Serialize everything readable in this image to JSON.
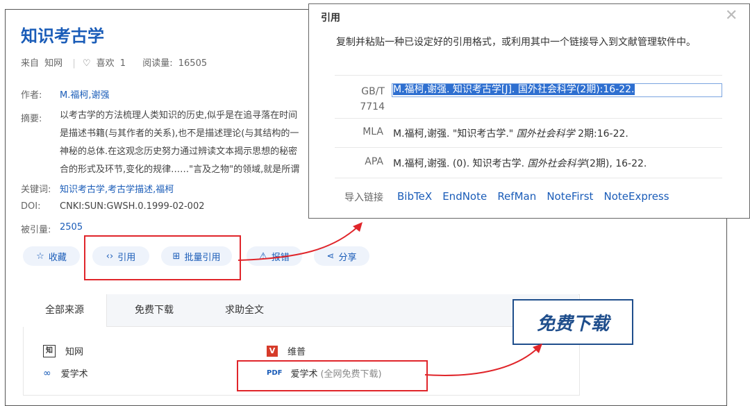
{
  "article": {
    "title": "知识考古学",
    "source_label": "来自",
    "source": "知网",
    "like_icon": "heart-icon",
    "like_label": "喜欢",
    "like_count": "1",
    "reads_label": "阅读量:",
    "reads": "16505",
    "author_label": "作者:",
    "authors": "M.福柯,谢强",
    "abstract_label": "摘要:",
    "abstract_lines": [
      "以考古学的方法梳理人类知识的历史,似乎是在追寻落在时间",
      "是描述书籍(与其作者的关系),也不是描述理论(与其结构的一",
      "神秘的总体.在这观念历史努力通过辨读文本揭示思想的秘密",
      "合的形式及环节,变化的规律……\"言及之物\"的领域,就是所谓"
    ],
    "keywords_label": "关键词:",
    "keywords": "知识考古学,考古学描述,福柯",
    "doi_label": "DOI:",
    "doi": "CNKI:SUN:GWSH.0.1999-02-002",
    "cited_label": "被引量:",
    "cited": "2505"
  },
  "actions": [
    {
      "label": "收藏",
      "icon": "star-icon"
    },
    {
      "label": "引用",
      "icon": "code-icon"
    },
    {
      "label": "批量引用",
      "icon": "folder-plus-icon"
    },
    {
      "label": "报错",
      "icon": "warning-icon"
    },
    {
      "label": "分享",
      "icon": "share-icon"
    }
  ],
  "tabs": [
    "全部来源",
    "免费下载",
    "求助全文"
  ],
  "sources": [
    {
      "name": "知网",
      "icon": "cnki-icon"
    },
    {
      "name": "维普",
      "icon": "vip-icon"
    },
    {
      "name": "爱学术",
      "icon": "link-icon"
    },
    {
      "name": "爱学术",
      "icon": "pdf-icon",
      "icon_text": "PDF",
      "note": "(全网免费下载)"
    }
  ],
  "callout": "免费下载",
  "citation": {
    "title": "引用",
    "description": "复制并粘贴一种已设定好的引用格式，或利用其中一个链接导入到文献管理软件中。",
    "formats": [
      {
        "label": "GB/T 7714",
        "text": "M.福柯,谢强. 知识考古学[J]. 国外社会科学(2期):16-22."
      },
      {
        "label": "MLA",
        "text_a": "M.福柯,谢强. \"知识考古学.\" ",
        "text_i": "国外社会科学",
        "text_b": " 2期:16-22."
      },
      {
        "label": "APA",
        "text_a": "M.福柯,谢强. (0). 知识考古学. ",
        "text_i": "国外社会科学",
        "text_b": "(2期), 16-22."
      }
    ],
    "import_label": "导入链接",
    "import_links": [
      "BibTeX",
      "EndNote",
      "RefMan",
      "NoteFirst",
      "NoteExpress"
    ]
  },
  "colors": {
    "link": "#1a5cb8",
    "highlight": "#e0252a",
    "callout": "#1f4e8c"
  }
}
